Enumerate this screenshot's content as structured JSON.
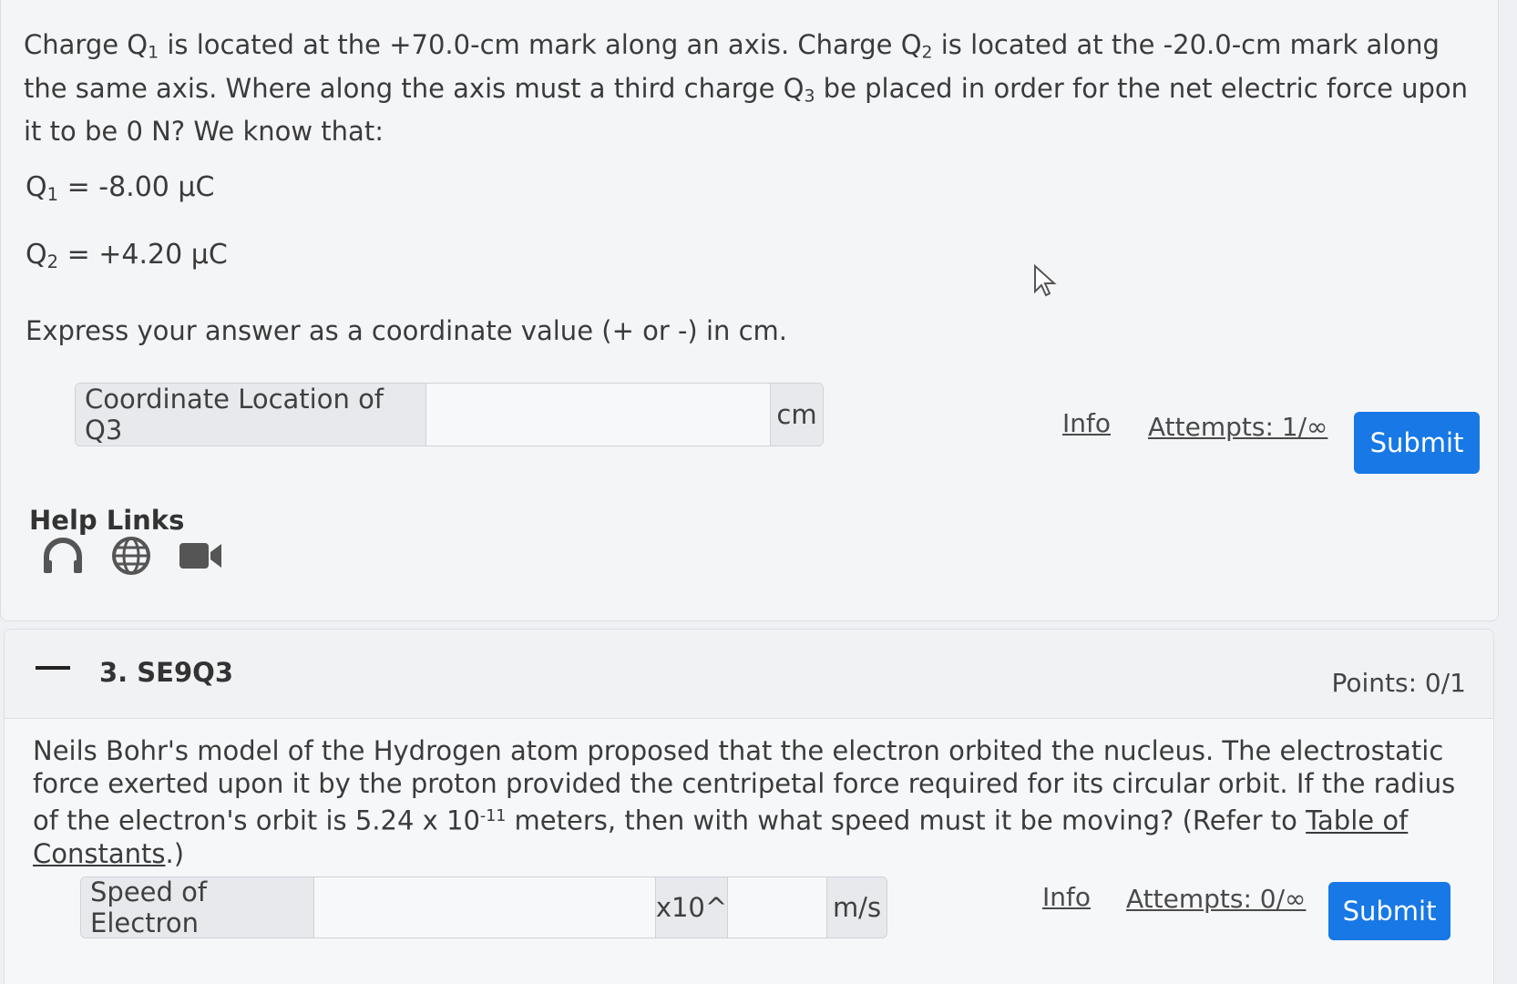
{
  "question2": {
    "text_part1": "Charge Q",
    "sub1": "1",
    "text_part2": " is located at the +70.0-cm mark along an axis. Charge Q",
    "sub2": "2",
    "text_part3": " is located at the -20.0-cm mark along the same axis. Where along the axis must a third charge Q",
    "sub3": "3",
    "text_part4": " be placed in order for the net electric force upon it to be 0 N? We know that:",
    "eq1_label": "Q",
    "eq1_sub": "1",
    "eq1_value": " = -8.00 μC",
    "eq2_label": "Q",
    "eq2_sub": "2",
    "eq2_value": " = +4.20 μC",
    "instruction": "Express your answer as a coordinate value (+ or -) in cm.",
    "input_label": "Coordinate Location of Q3",
    "input_value": "",
    "unit": "cm",
    "info_link": "Info",
    "attempts": "Attempts: 1/∞",
    "submit": "Submit"
  },
  "help": {
    "title": "Help Links",
    "icons": [
      "headphones-icon",
      "globe-icon",
      "video-camera-icon"
    ]
  },
  "question3": {
    "title": "3. SE9Q3",
    "points": "Points: 0/1",
    "text_part1": "Neils Bohr's model of the Hydrogen atom proposed that the electron orbited the nucleus. The electrostatic force exerted upon it by the proton provided the centripetal force required for its circular orbit. If the radius of the electron's orbit is 5.24 x 10",
    "exponent": "-11",
    "text_part2": " meters, then with what speed must it be moving? (Refer to ",
    "constants_link": "Table of Constants",
    "text_part3": ".)",
    "input_label": "Speed of Electron",
    "mantissa_value": "",
    "x10_label": "x10^",
    "exponent_value": "",
    "unit": "m/s",
    "info_link": "Info",
    "attempts": "Attempts: 0/∞",
    "submit": "Submit"
  },
  "colors": {
    "accent": "#1778e6",
    "background": "#eef0f3"
  }
}
